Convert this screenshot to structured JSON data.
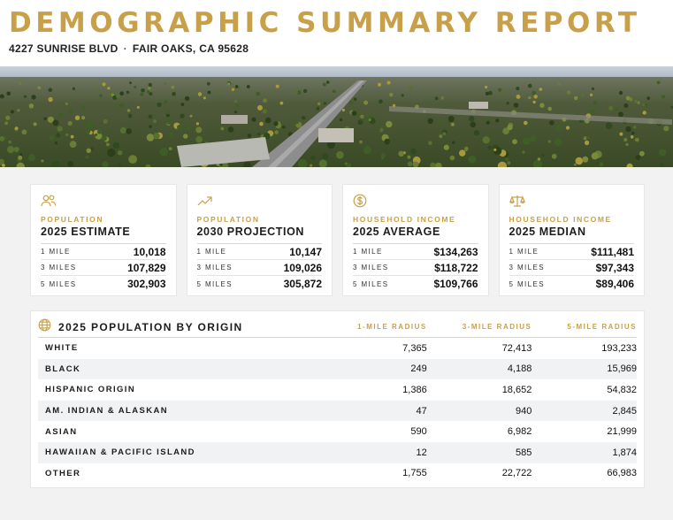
{
  "header": {
    "title": "DEMOGRAPHIC SUMMARY REPORT",
    "street": "4227 SUNRISE BLVD",
    "separator": "·",
    "city": "FAIR OAKS, CA 95628"
  },
  "colors": {
    "accent": "#c9a04a",
    "text": "#1d1d1d",
    "background": "#f2f2f2",
    "row_alt": "#f0f2f4"
  },
  "cards": [
    {
      "icon": "people-icon",
      "label": "POPULATION",
      "title": "2025 ESTIMATE",
      "rows": [
        {
          "k": "1 MILE",
          "v": "10,018"
        },
        {
          "k": "3 MILES",
          "v": "107,829"
        },
        {
          "k": "5 MILES",
          "v": "302,903"
        }
      ]
    },
    {
      "icon": "trend-up-icon",
      "label": "POPULATION",
      "title": "2030 PROJECTION",
      "rows": [
        {
          "k": "1 MILE",
          "v": "10,147"
        },
        {
          "k": "3 MILES",
          "v": "109,026"
        },
        {
          "k": "5 MILES",
          "v": "305,872"
        }
      ]
    },
    {
      "icon": "dollar-icon",
      "label": "HOUSEHOLD INCOME",
      "title": "2025 AVERAGE",
      "rows": [
        {
          "k": "1 MILE",
          "v": "$134,263"
        },
        {
          "k": "3 MILES",
          "v": "$118,722"
        },
        {
          "k": "5 MILES",
          "v": "$109,766"
        }
      ]
    },
    {
      "icon": "scale-icon",
      "label": "HOUSEHOLD INCOME",
      "title": "2025 MEDIAN",
      "rows": [
        {
          "k": "1 MILE",
          "v": "$111,481"
        },
        {
          "k": "3 MILES",
          "v": "$97,343"
        },
        {
          "k": "5 MILES",
          "v": "$89,406"
        }
      ]
    }
  ],
  "origin_table": {
    "icon": "globe-icon",
    "title": "2025 POPULATION BY ORIGIN",
    "columns": [
      "1-MILE RADIUS",
      "3-MILE RADIUS",
      "5-MILE RADIUS"
    ],
    "rows": [
      {
        "name": "WHITE",
        "values": [
          "7,365",
          "72,413",
          "193,233"
        ]
      },
      {
        "name": "BLACK",
        "values": [
          "249",
          "4,188",
          "15,969"
        ]
      },
      {
        "name": "HISPANIC ORIGIN",
        "values": [
          "1,386",
          "18,652",
          "54,832"
        ]
      },
      {
        "name": "AM. INDIAN & ALASKAN",
        "values": [
          "47",
          "940",
          "2,845"
        ]
      },
      {
        "name": "ASIAN",
        "values": [
          "590",
          "6,982",
          "21,999"
        ]
      },
      {
        "name": "HAWAIIAN & PACIFIC ISLAND",
        "values": [
          "12",
          "585",
          "1,874"
        ]
      },
      {
        "name": "OTHER",
        "values": [
          "1,755",
          "22,722",
          "66,983"
        ]
      }
    ]
  }
}
